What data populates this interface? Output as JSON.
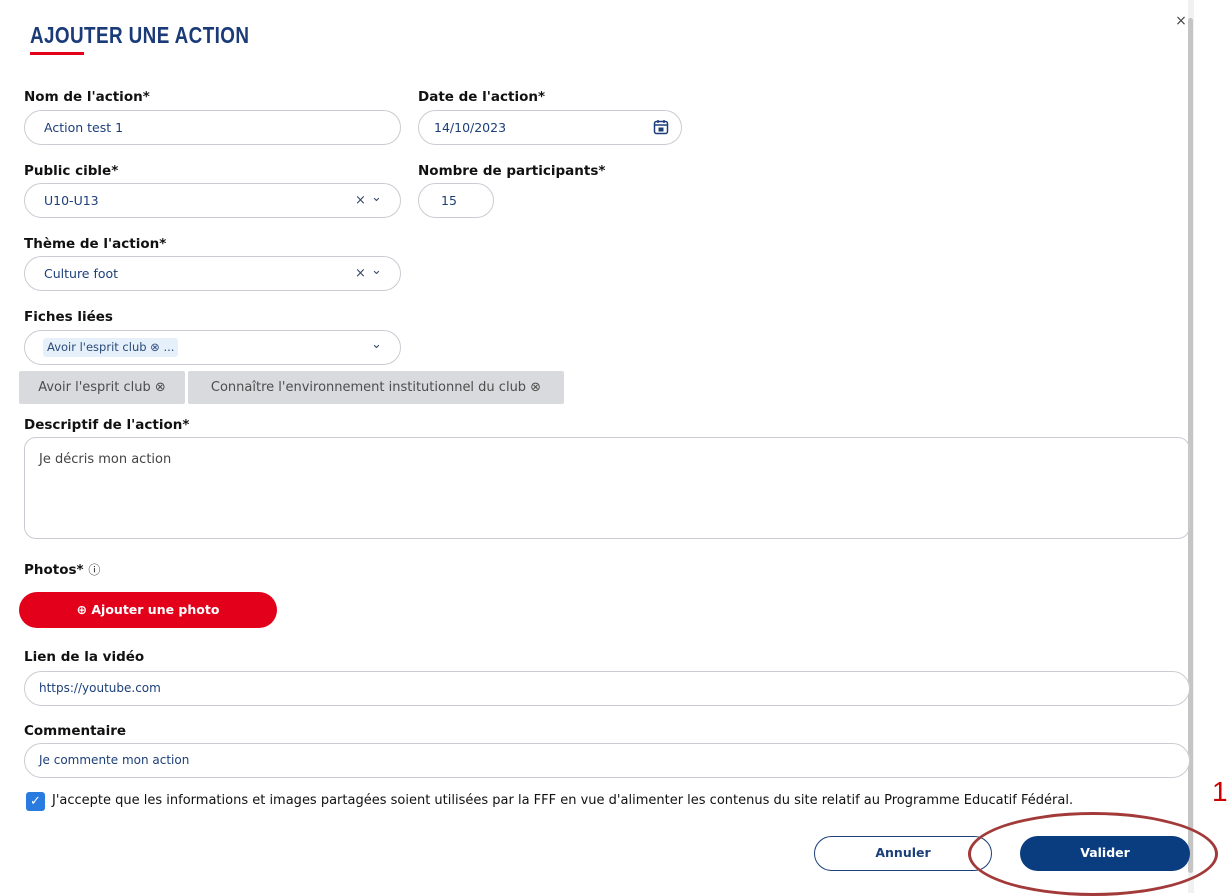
{
  "modal": {
    "title": "AJOUTER UNE ACTION",
    "close_icon": "×"
  },
  "fields": {
    "nom": {
      "label": "Nom de l'action*",
      "value": "Action test 1"
    },
    "date": {
      "label": "Date de l'action*",
      "value": "14/10/2023",
      "icon": "calendar-icon"
    },
    "public": {
      "label": "Public cible*",
      "value": "U10-U13",
      "clear": "×",
      "chevron": "⌄"
    },
    "participants": {
      "label": "Nombre de participants*",
      "value": "15"
    },
    "theme": {
      "label": "Thème de l'action*",
      "value": "Culture foot",
      "clear": "×",
      "chevron": "⌄"
    },
    "fiches": {
      "label": "Fiches liées",
      "selected_preview": "Avoir l'esprit club ⊗ ...",
      "chevron": "⌄",
      "chips": [
        "Avoir l'esprit club ⊗",
        "Connaître l'environnement institutionnel du club ⊗"
      ]
    },
    "descriptif": {
      "label": "Descriptif de l'action*",
      "value": "Je décris mon action"
    },
    "photos": {
      "label": "Photos*",
      "info_icon": "ⓘ",
      "button": "⊕ Ajouter une photo"
    },
    "video": {
      "label": "Lien de la vidéo",
      "value": "https://youtube.com"
    },
    "commentaire": {
      "label": "Commentaire",
      "value": "Je commente mon action"
    }
  },
  "consent": {
    "checked": true,
    "check_mark": "✓",
    "text": "J'accepte que les informations et images partagées soient utilisées par la FFF en vue d'alimenter les contenus du site relatif au Programme Educatif Fédéral."
  },
  "actions": {
    "cancel": "Annuler",
    "submit": "Valider"
  },
  "annotation": {
    "number": "1"
  },
  "colors": {
    "brand_blue": "#1a3a78",
    "brand_red": "#e2001a",
    "submit_blue": "#0a3d80",
    "annotation_red": "#a33a3a"
  }
}
